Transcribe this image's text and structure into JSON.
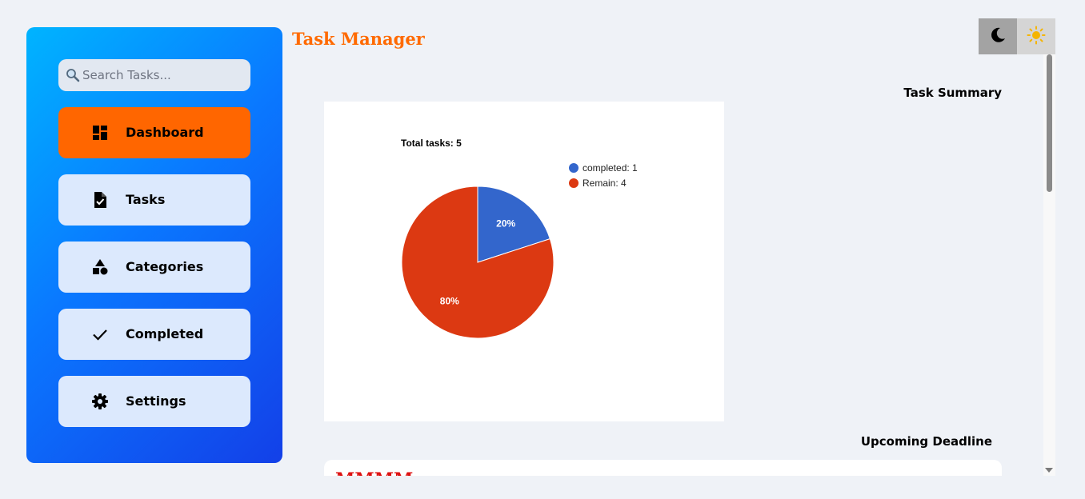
{
  "app": {
    "title": "Task Manager"
  },
  "search": {
    "placeholder": "Search Tasks..."
  },
  "sidebar": {
    "items": [
      {
        "label": "Dashboard",
        "icon": "dashboard-icon",
        "active": true
      },
      {
        "label": "Tasks",
        "icon": "task-file-icon",
        "active": false
      },
      {
        "label": "Categories",
        "icon": "shapes-icon",
        "active": false
      },
      {
        "label": "Completed",
        "icon": "checkmark-icon",
        "active": false
      },
      {
        "label": "Settings",
        "icon": "gear-icon",
        "active": false
      }
    ]
  },
  "theme": {
    "dark_icon": "moon-icon",
    "light_icon": "sun-icon"
  },
  "summary": {
    "title": "Task Summary"
  },
  "deadline": {
    "title": "Upcoming Deadline",
    "first_item_text": "MMMM"
  },
  "colors": {
    "accent": "#ff6600",
    "completed": "#3366cc",
    "remain": "#dc3912"
  },
  "chart_data": {
    "type": "pie",
    "title": "Total tasks: 5",
    "legend_position": "right",
    "slices": [
      {
        "label": "completed: 1",
        "value": 1,
        "percent_label": "20%",
        "color": "#3366cc"
      },
      {
        "label": "Remain: 4",
        "value": 4,
        "percent_label": "80%",
        "color": "#dc3912"
      }
    ]
  }
}
